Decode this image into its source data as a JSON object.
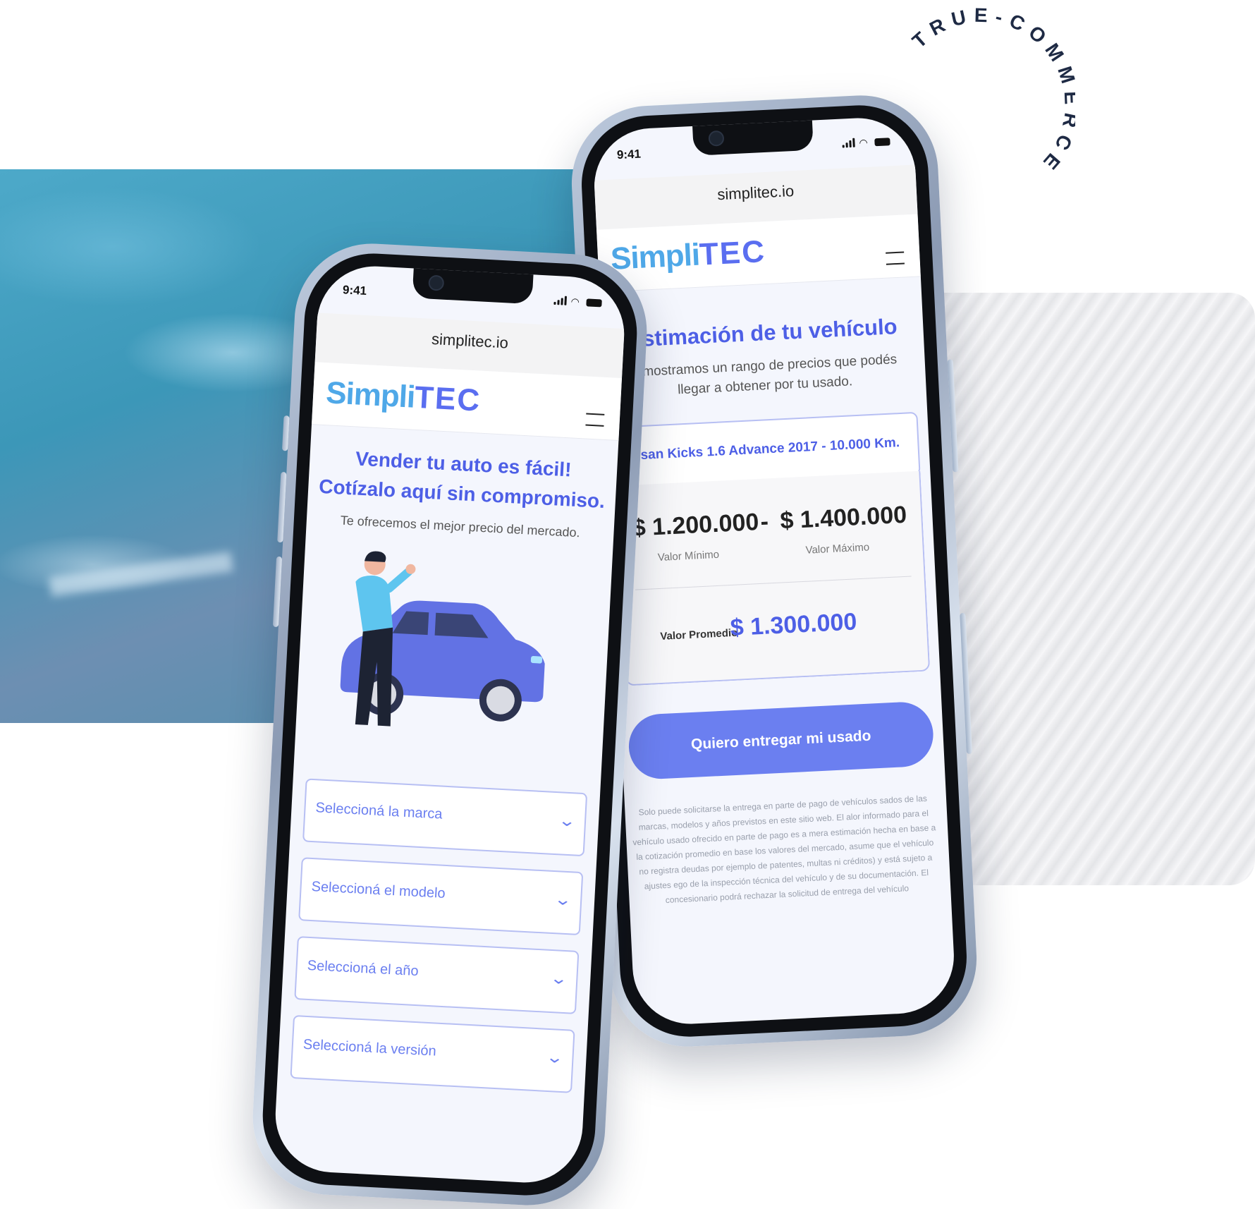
{
  "badge": {
    "text": "TRUE-COMMERCE"
  },
  "phone_left": {
    "status_time": "9:41",
    "url": "simplitec.io",
    "logo_main": "Simpli",
    "logo_accent": "TEC",
    "headline_line1": "Vender tu auto es fácil!",
    "headline_line2": "Cotízalo aquí sin compromiso.",
    "subtitle": "Te ofrecemos el mejor precio del mercado.",
    "selects": [
      {
        "placeholder": "Seleccioná la marca"
      },
      {
        "placeholder": "Seleccioná el modelo"
      },
      {
        "placeholder": "Seleccioná el año"
      },
      {
        "placeholder": "Seleccioná la versión"
      }
    ]
  },
  "phone_right": {
    "status_time": "9:41",
    "url": "simplitec.io",
    "logo_main": "Simpli",
    "logo_accent": "TEC",
    "title": "Estimación de tu vehículo",
    "subtitle_line1": "e mostramos un rango de precios que podés",
    "subtitle_line2": "llegar a obtener por tu usado.",
    "vehicle": "Nissan Kicks 1.6 Advance 2017 - 10.000 Km.",
    "min_value": "$ 1.200.000",
    "separator": "-",
    "max_value": "$ 1.400.000",
    "min_label": "Valor Mínimo",
    "max_label": "Valor Máximo",
    "avg_label": "Valor Promedio",
    "avg_value": "$ 1.300.000",
    "cta_label": "Quiero entregar mi usado",
    "disclaimer": "Solo puede solicitarse la entrega en parte de pago de vehículos sados de las marcas, modelos y años previstos en este sitio web. El alor informado para el vehículo usado ofrecido en parte de pago es a mera estimación hecha en base a la cotización promedio en base los valores del mercado, asume que el vehículo no registra deudas por ejemplo de patentes, multas ni créditos) y está sujeto a ajustes ego de la inspección técnica del vehículo y de su documentación. El concesionario podrá rechazar la solicitud de entrega del vehículo"
  },
  "colors": {
    "brand_blue": "#4d5fe6",
    "logo_light_blue": "#4fa8e8",
    "cta": "#6b7ff0",
    "badge": "#1e2a44"
  }
}
